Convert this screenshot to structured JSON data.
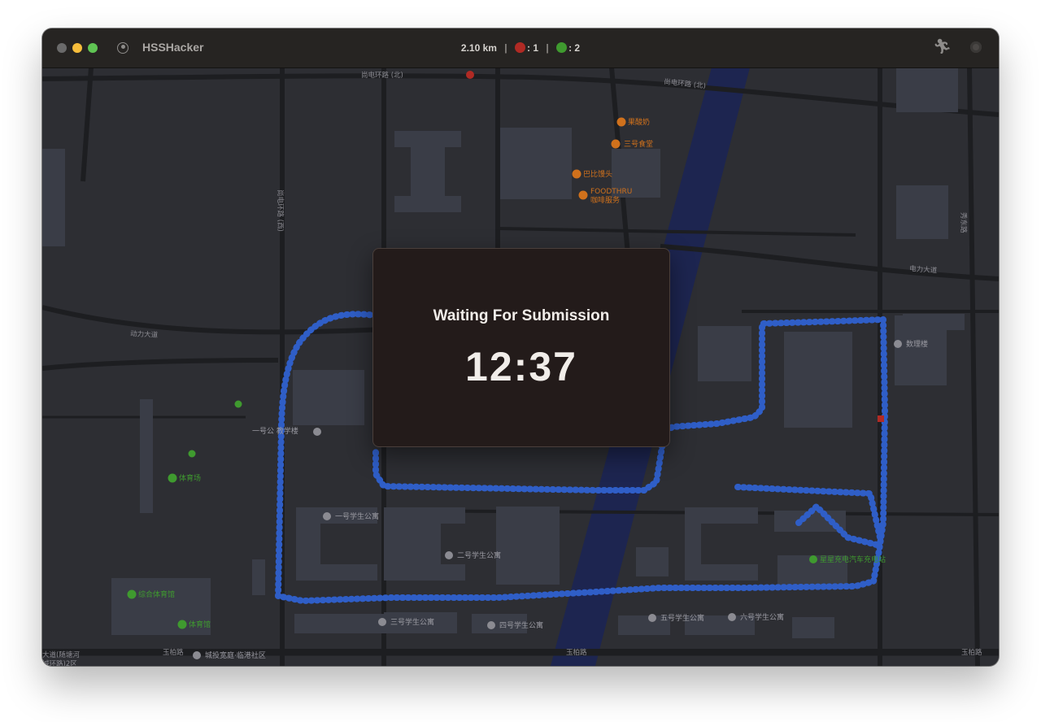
{
  "window": {
    "title": "HSSHacker",
    "status": {
      "distance": "2.10 km",
      "separator": "|",
      "red_count": ": 1",
      "green_count": ": 2"
    },
    "icons": {
      "profile": "person-circle-icon",
      "runner": "running-figure-icon",
      "record": "record-dot-icon"
    }
  },
  "modal": {
    "title": "Waiting For Submission",
    "timer": "12:37"
  },
  "map": {
    "road_labels": [
      "尚电环路 (北)",
      "尚电环路 (北)",
      "尚电环路 (西)",
      "动力大道",
      "电力大道",
      "秀东路",
      "玉柏路",
      "玉柏路",
      "玉柏路",
      "大道(随塘河",
      "城环路)2区"
    ],
    "poi_labels": [
      "果酸奶",
      "三号食堂",
      "巴比馒头",
      "FOODTHRU",
      "咖啡服务",
      "数理楼",
      "一号公 教学楼",
      "体育场",
      "一号学生公寓",
      "二号学生公寓",
      "星星充电汽车充电站",
      "综合体育馆",
      "体育馆",
      "三号学生公寓",
      "四号学生公寓",
      "五号学生公寓",
      "六号学生公寓",
      "城投宽庭·临港社区"
    ],
    "colors": {
      "background": "#2d2e33",
      "road": "#1c1d20",
      "building": "#3a3d47",
      "river": "#1d2550",
      "route": "#2f5ec7",
      "poi_orange": "#d0711c",
      "poi_green": "#3f9a2f",
      "marker_red": "#b02a24"
    }
  }
}
